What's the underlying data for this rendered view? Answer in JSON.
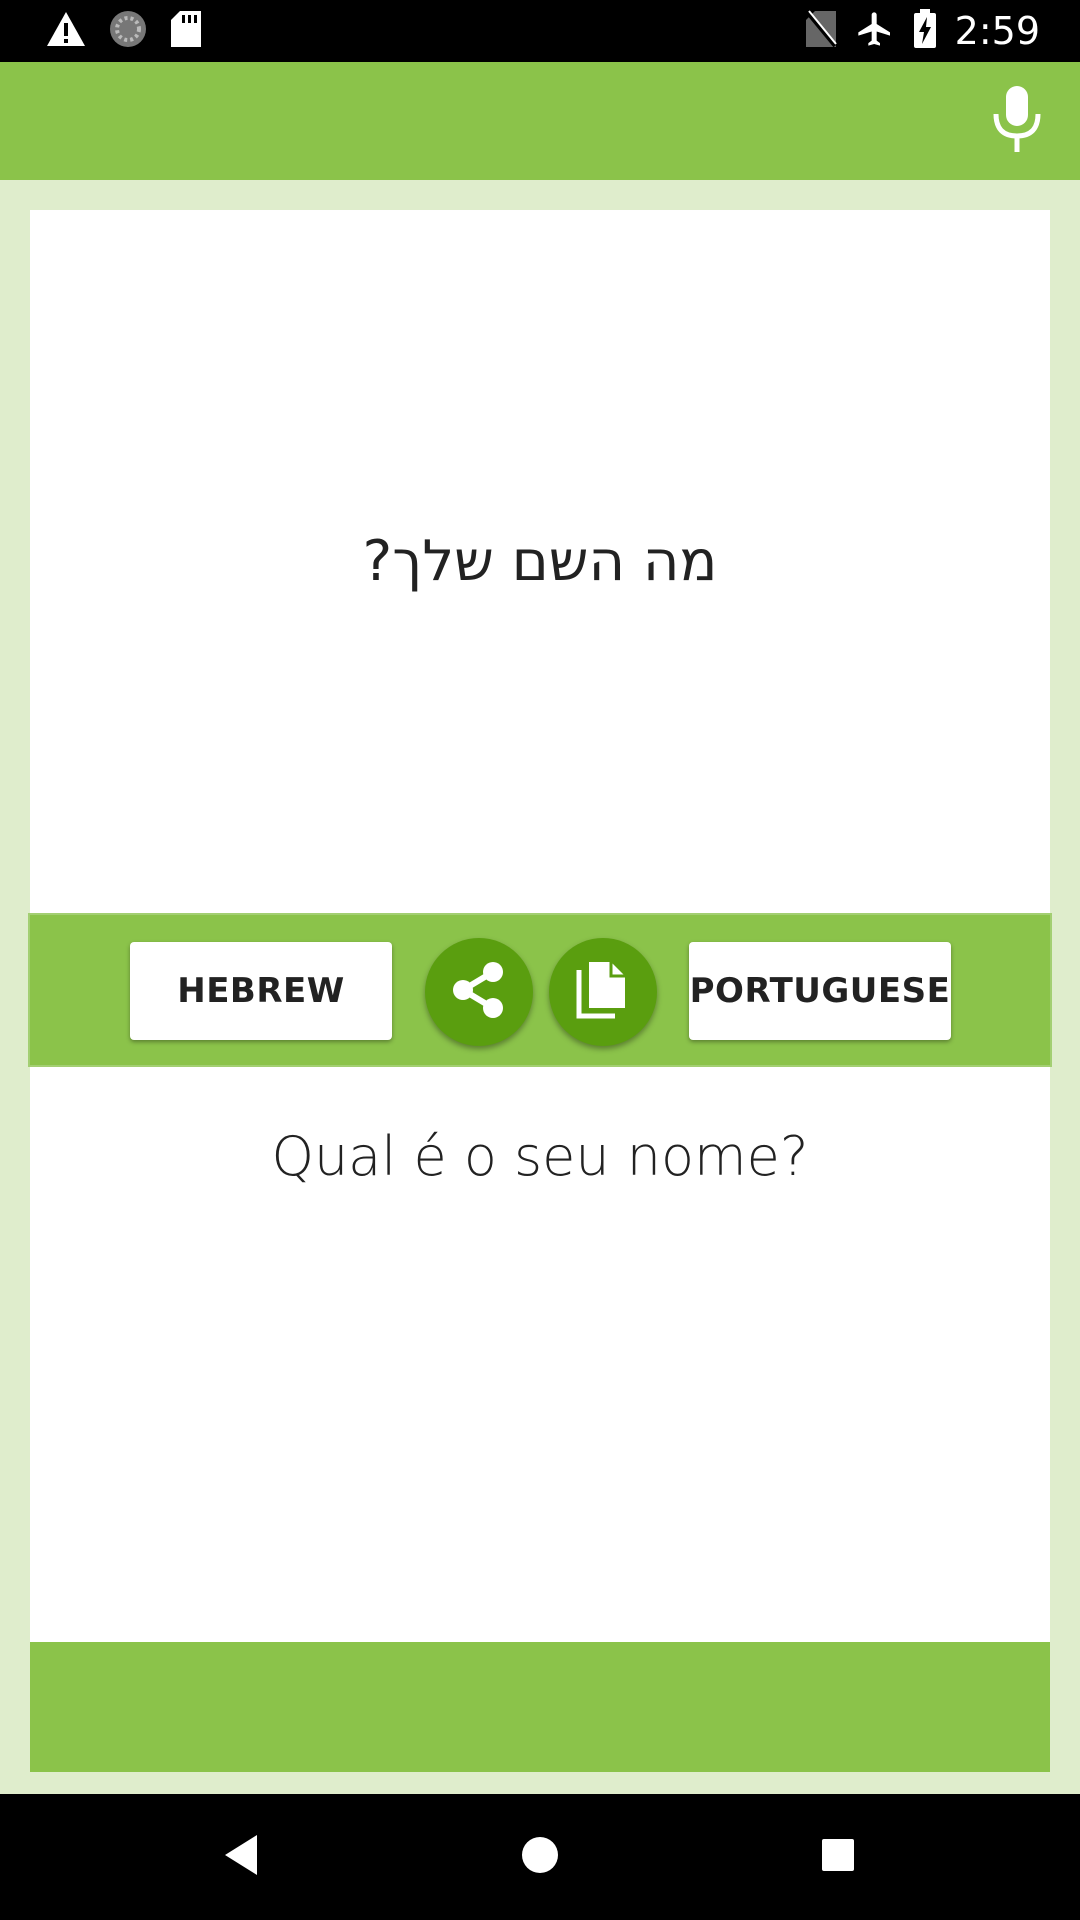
{
  "status_bar": {
    "time": "2:59",
    "icons": [
      "warning-icon",
      "sync-icon",
      "sd-card-icon",
      "no-sim-icon",
      "airplane-mode-icon",
      "battery-charging-icon"
    ]
  },
  "app_bar": {
    "mic_icon": "microphone-icon"
  },
  "translation": {
    "source_text": "מה השם שלך?",
    "target_text": "Qual é o seu nome?"
  },
  "controls": {
    "source_language": "HEBREW",
    "target_language": "PORTUGUESE",
    "share_icon": "share-icon",
    "copy_icon": "copy-icon"
  },
  "navigation": {
    "icons": [
      "back-icon",
      "home-icon",
      "recents-icon"
    ]
  },
  "colors": {
    "primary": "#8bc34a",
    "primary_dark_button": "#5a9e0f",
    "background": "#dfedcc"
  }
}
